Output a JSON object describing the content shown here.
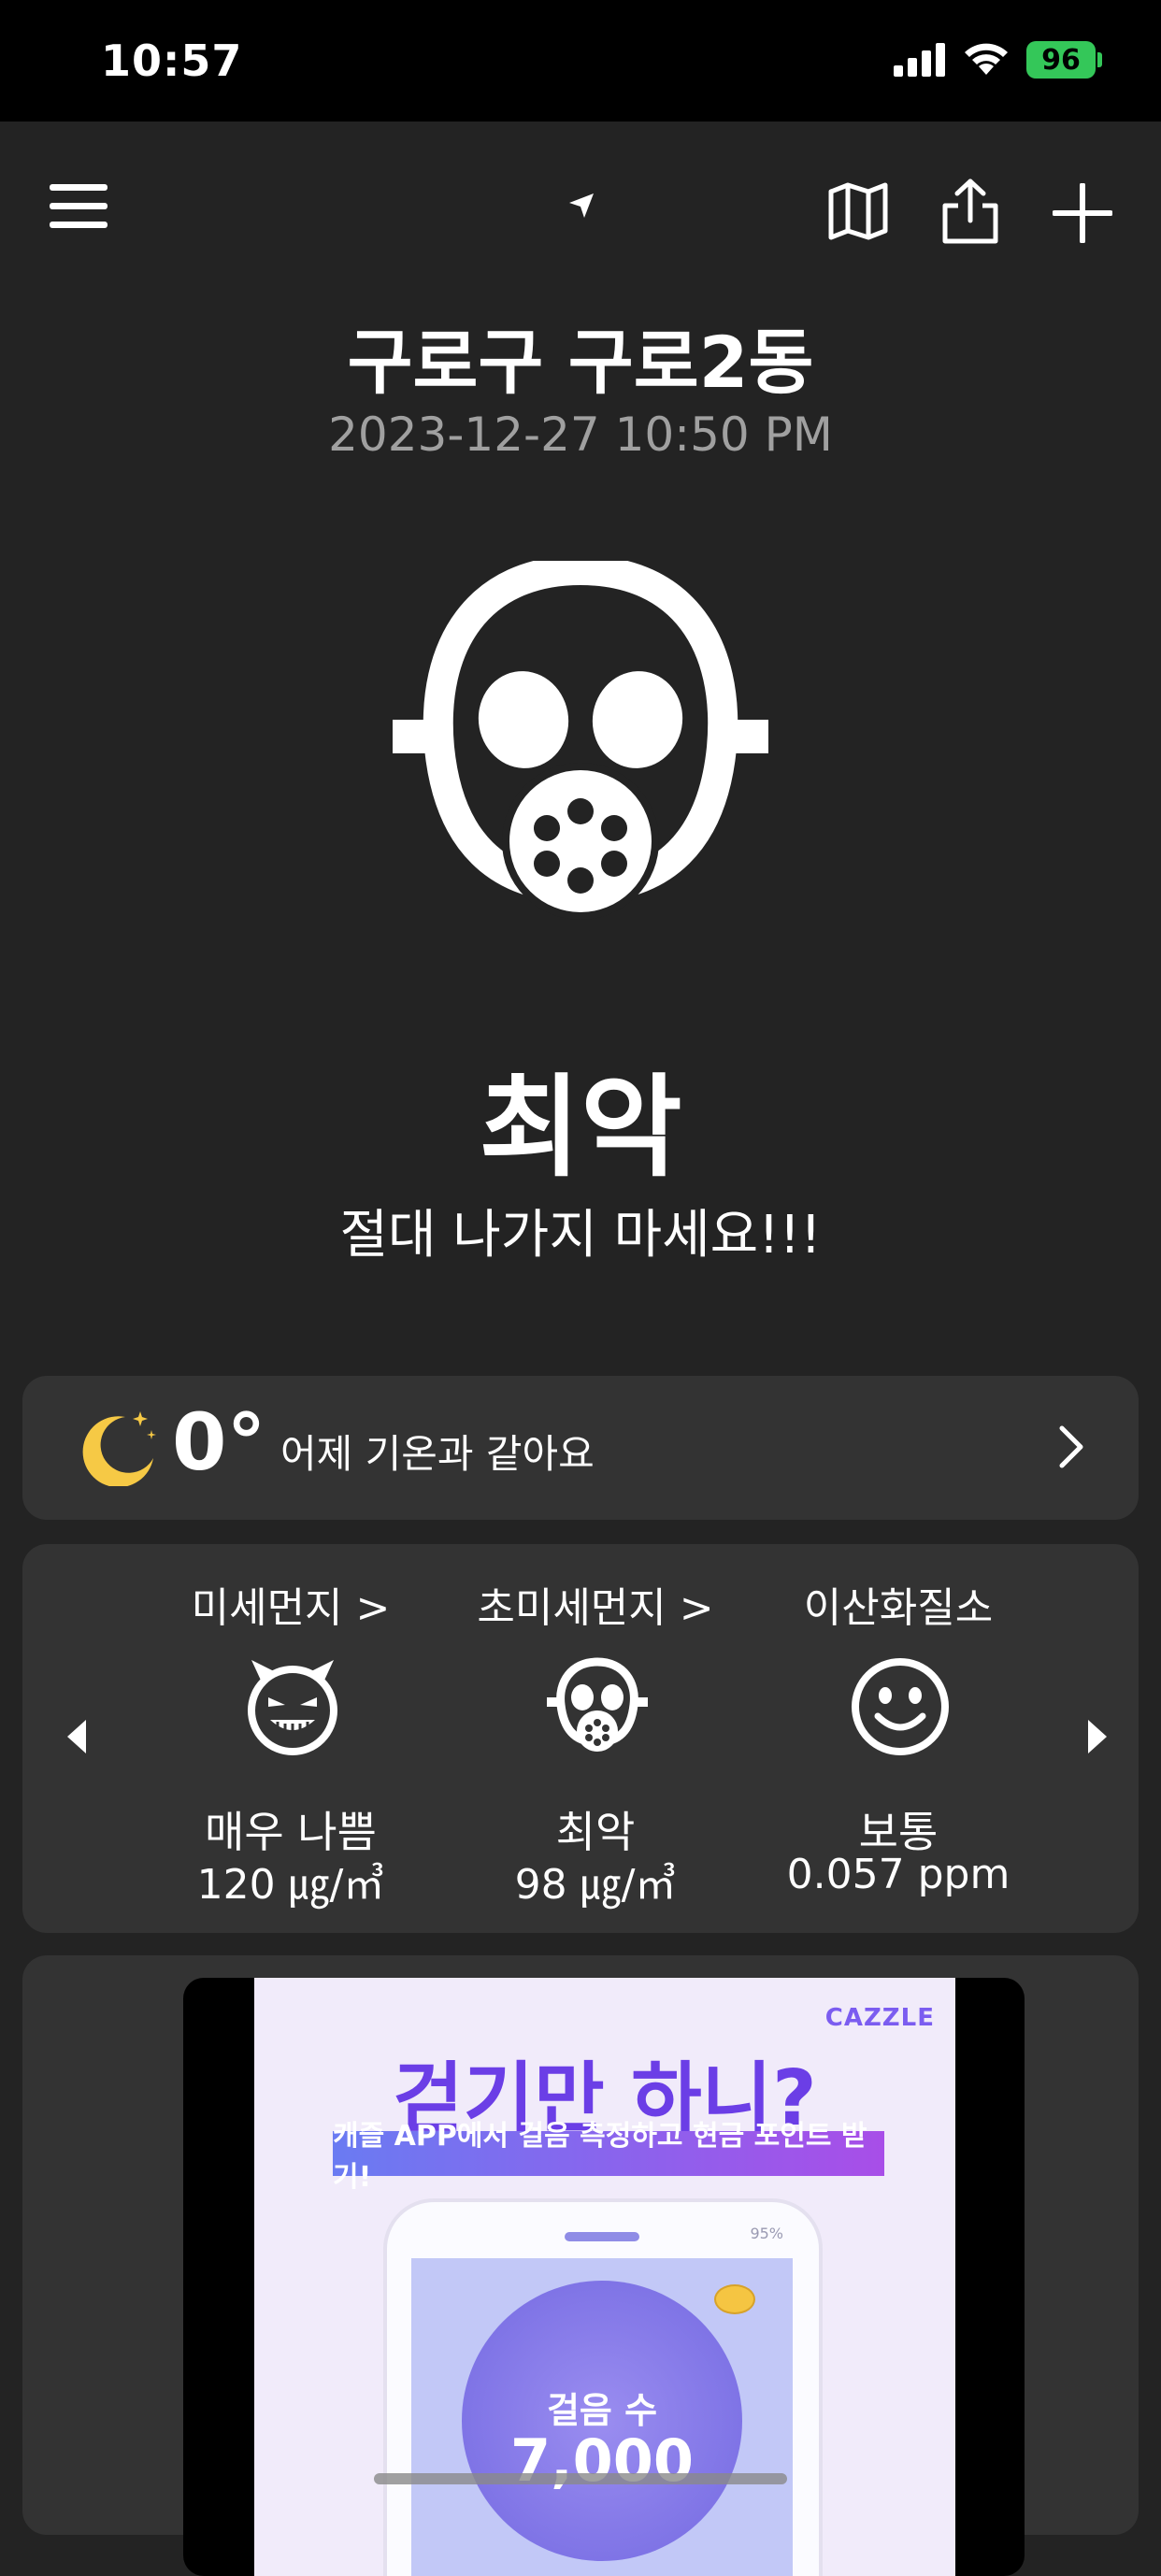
{
  "status_bar": {
    "time": "10:57",
    "battery": "96"
  },
  "location": {
    "name": "구로구 구로2동",
    "datetime": "2023-12-27 10:50 PM"
  },
  "main_status": {
    "grade": "최악",
    "message": "절대 나가지 마세요!!!"
  },
  "weather": {
    "temperature": "0°",
    "comparison": "어제 기온과 같아요"
  },
  "air_quality": [
    {
      "label": "미세먼지 >",
      "grade": "매우 나쁨",
      "value": "120 ㎍/㎥",
      "icon": "devil-face-icon"
    },
    {
      "label": "초미세먼지 >",
      "grade": "최악",
      "value": "98 ㎍/㎥",
      "icon": "gas-mask-icon"
    },
    {
      "label": "이산화질소",
      "grade": "보통",
      "value": "0.057 ppm",
      "icon": "smiley-face-icon"
    }
  ],
  "ad": {
    "brand": "CAZZLE",
    "headline": "걷기만 하니?",
    "subline": "캐즐 APP에서 걸음 측정하고 현금 포인트 받기!",
    "phone_status": "95%",
    "steps_label": "걸음 수",
    "steps_value": "7,000"
  },
  "colors": {
    "background": "#232323",
    "card": "#333333",
    "battery": "#34c759",
    "moon": "#f6c945",
    "ad_purple": "#6b3ee6"
  }
}
